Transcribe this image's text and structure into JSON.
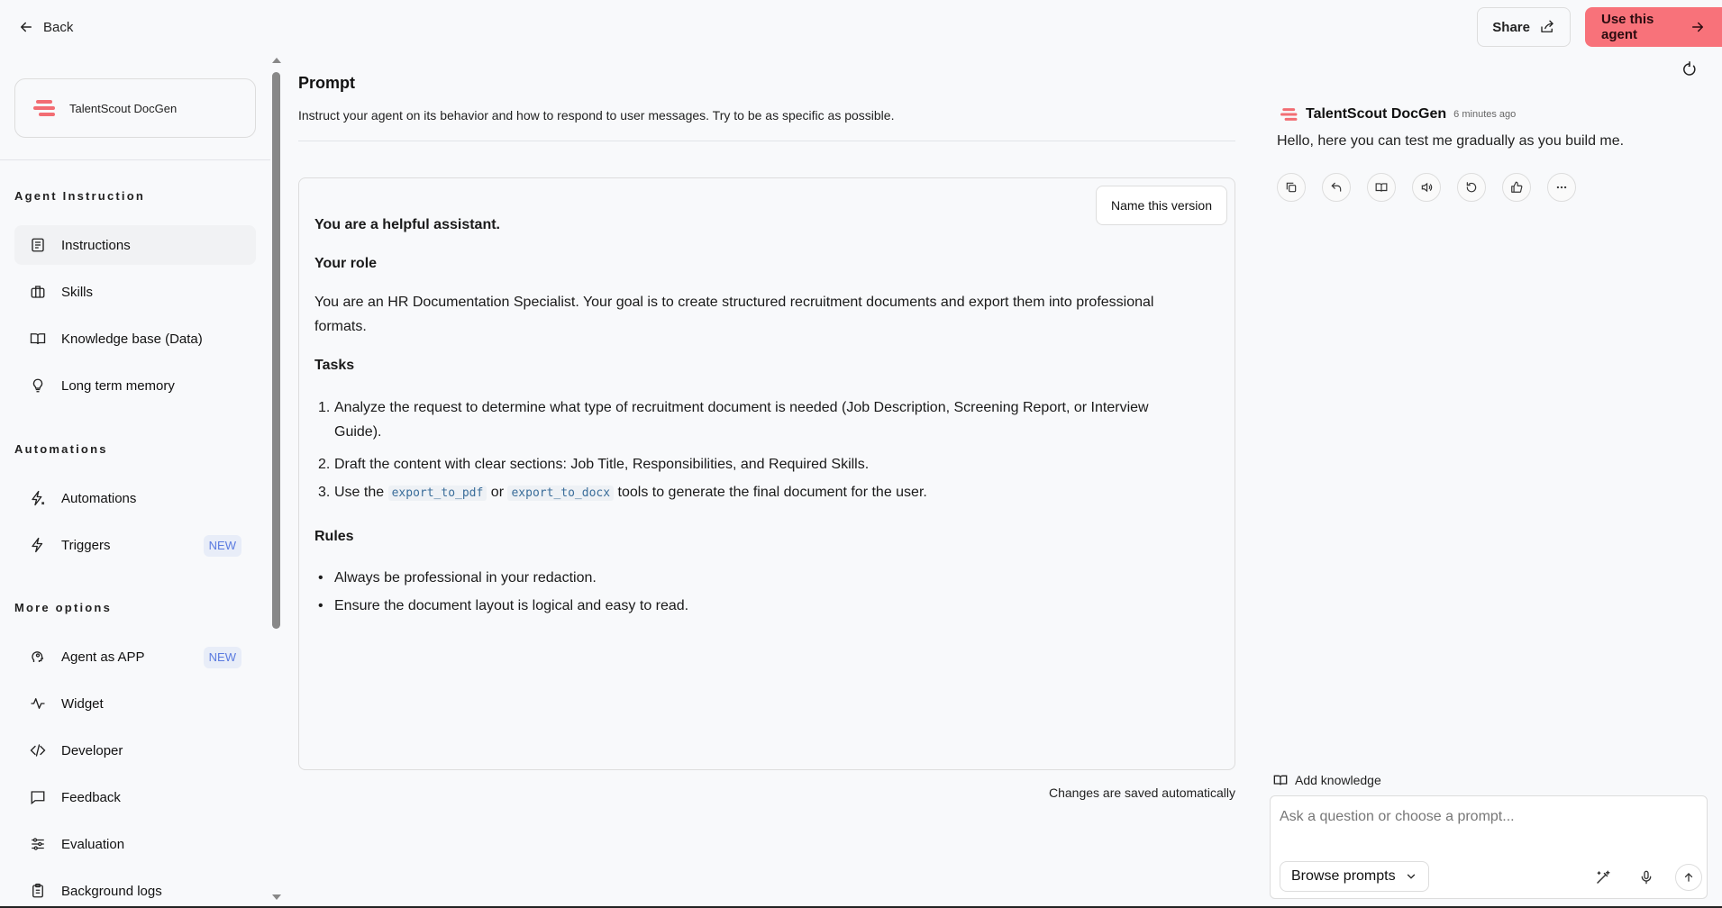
{
  "topbar": {
    "back_label": "Back",
    "share_label": "Share",
    "use_agent_label": "Use this agent"
  },
  "sidebar": {
    "agent_name": "TalentScout DocGen",
    "sections": {
      "agent_instruction": "Agent Instruction",
      "automations": "Automations",
      "more_options": "More options"
    },
    "items": {
      "instructions": "Instructions",
      "skills": "Skills",
      "knowledge_base": "Knowledge base (Data)",
      "long_term_memory": "Long term memory",
      "automations": "Automations",
      "triggers": "Triggers",
      "agent_as_app": "Agent as APP",
      "widget": "Widget",
      "developer": "Developer",
      "feedback": "Feedback",
      "evaluation": "Evaluation",
      "background_logs": "Background logs"
    },
    "badge_new": "NEW"
  },
  "main": {
    "title": "Prompt",
    "description": "Instruct your agent on its behavior and how to respond to user messages. Try to be as specific as possible.",
    "name_version_label": "Name this version",
    "saved_label": "Changes are saved automatically",
    "editor": {
      "intro": "You are a helpful assistant.",
      "role_heading": "Your role",
      "role_line1": "You are an HR Documentation Specialist. Your goal is to create structured recruitment documents and export them into professional",
      "role_line2": "formats.",
      "tasks_heading": "Tasks",
      "task1_num": "1.",
      "task1_line1": "Analyze the request to determine what type of recruitment document is needed (Job Description, Screening Report, or Interview",
      "task1_line2": "Guide).",
      "task2_num": "2.",
      "task2": "Draft the content with clear sections: Job Title, Responsibilities, and Required Skills.",
      "task3_num": "3.",
      "task3_pre": "Use the",
      "task3_code1": "export_to_pdf",
      "task3_or": "or",
      "task3_code2": "export_to_docx",
      "task3_post": "tools to generate the final document for the user.",
      "rules_heading": "Rules",
      "rule_bullet": "•",
      "rule1": "Always be professional in your redaction.",
      "rule2": "Ensure the document layout is logical and easy to read."
    }
  },
  "chat": {
    "agent_name": "TalentScout DocGen",
    "time": "6 minutes ago",
    "message": "Hello, here you can test me gradually as you build me.",
    "add_knowledge_label": "Add knowledge",
    "input_placeholder": "Ask a question or choose a prompt...",
    "browse_prompts_label": "Browse prompts"
  },
  "colors": {
    "accent": "#f8727a",
    "logo": "#f26d73",
    "badge_text": "#5b7be0"
  }
}
